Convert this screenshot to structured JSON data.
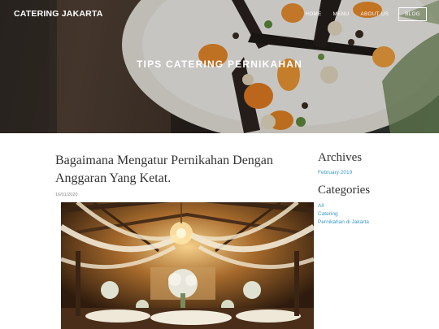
{
  "header": {
    "brand": "CATERING JAKARTA",
    "nav": [
      "HOME",
      "MENU",
      "ABOUT US",
      "BLOG"
    ],
    "hero_title": "TIPS CATERING PERNIKAHAN"
  },
  "post": {
    "title_line1": "Bagaimana Mengatur Pernikahan Dengan",
    "title_line2": "Anggaran Yang Ketat.",
    "date": "16/01/2020"
  },
  "sidebar": {
    "archives_heading": "Archives",
    "archives": [
      "February 2019"
    ],
    "categories_heading": "Categories",
    "categories": [
      "All",
      "Catering",
      "Pernikahan di Jakarta"
    ]
  },
  "colors": {
    "link": "#3b98c9",
    "heading": "#333333",
    "hero_text": "#ffffff"
  }
}
